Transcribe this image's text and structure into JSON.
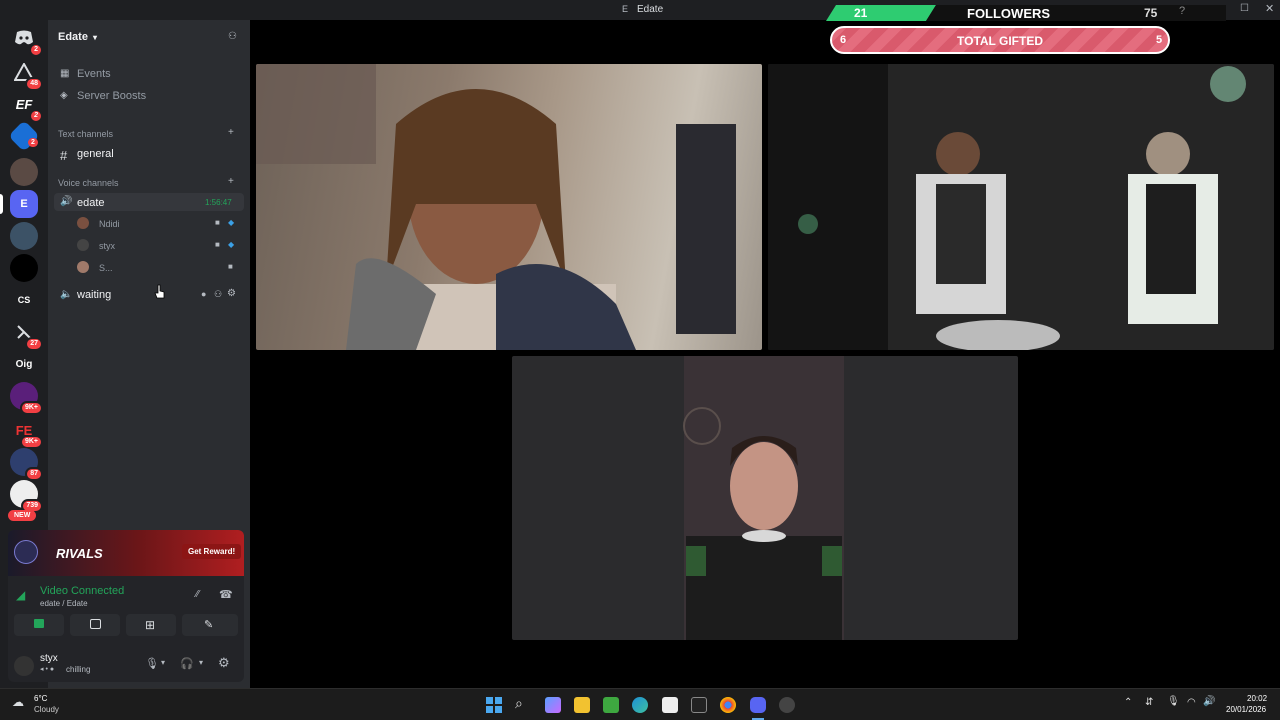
{
  "window": {
    "title": "Edate",
    "controls": [
      "minimize-icon",
      "maximize-icon",
      "close-icon"
    ]
  },
  "overlay": {
    "followers_count": "21",
    "followers_label": "FOLLOWERS",
    "followers_goal": "75",
    "gifted_left": "6",
    "gifted_label": "TOTAL GIFTED",
    "gifted_right": "5"
  },
  "rail": {
    "servers": [
      {
        "name": "discord-home",
        "badge": "2"
      },
      {
        "name": "server-a",
        "badge": "48"
      },
      {
        "name": "server-ef",
        "label": "EF",
        "badge": "2"
      },
      {
        "name": "server-blue",
        "badge": "2"
      },
      {
        "name": "server-photo1",
        "badge": ""
      },
      {
        "name": "server-edate",
        "label": "E",
        "badge": ""
      },
      {
        "name": "server-photo2",
        "badge": ""
      },
      {
        "name": "server-dark",
        "badge": ""
      },
      {
        "name": "server-cs",
        "label": "CS",
        "badge": ""
      },
      {
        "name": "server-27",
        "badge": "27"
      },
      {
        "name": "server-oig",
        "label": "Oig",
        "badge": ""
      },
      {
        "name": "server-purple",
        "badge": "9K+"
      },
      {
        "name": "server-fe",
        "label": "FE",
        "badge": "9K+"
      },
      {
        "name": "server-87",
        "badge": "87"
      },
      {
        "name": "server-739",
        "badge": "739"
      },
      {
        "name": "new-badge",
        "label": "NEW"
      }
    ]
  },
  "sidebar": {
    "server_name": "Edate",
    "menu": [
      {
        "label": "Events",
        "icon": "calendar-icon"
      },
      {
        "label": "Server Boosts",
        "icon": "boost-icon"
      }
    ],
    "text_category": "Text channels",
    "text_channels": [
      {
        "label": "general"
      }
    ],
    "voice_category": "Voice channels",
    "voice_channels": [
      {
        "label": "edate",
        "timer": "1:56:47",
        "users": [
          {
            "name": "Ndidi"
          },
          {
            "name": "styx"
          },
          {
            "name": "S..."
          }
        ]
      },
      {
        "label": "waiting"
      }
    ]
  },
  "promo": {
    "brand": "RIVALS",
    "button": "Get Reward!"
  },
  "voice_status": {
    "status": "Video Connected",
    "location": "edate / Edate"
  },
  "user": {
    "name": "styx",
    "status": "chilling"
  },
  "weather": {
    "temp": "6°C",
    "condition": "Cloudy"
  },
  "clock": {
    "time": "20:02",
    "date": "20/01/2026"
  },
  "colors": {
    "discord_green": "#23a55a",
    "badge_red": "#f23f43",
    "overlay_green": "#2ecc71",
    "overlay_pink": "#e46d7e"
  }
}
